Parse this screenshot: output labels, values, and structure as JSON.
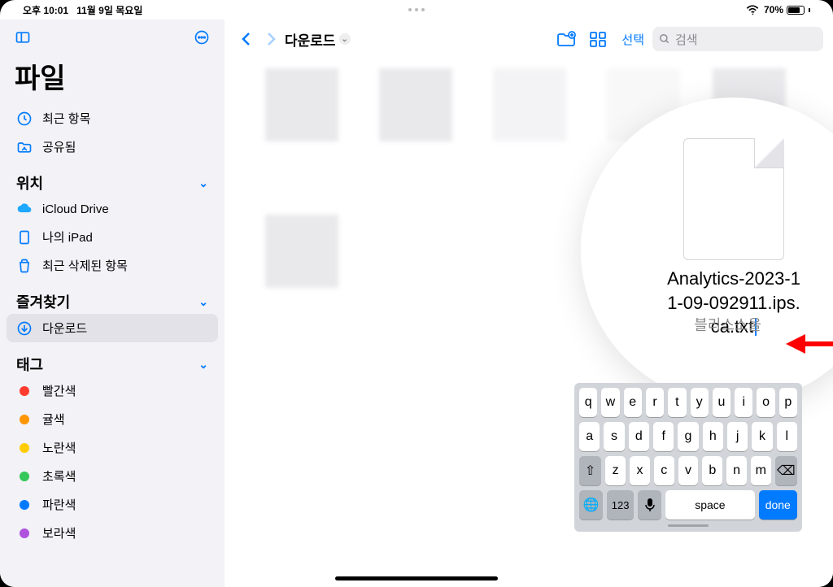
{
  "status": {
    "time": "오후 10:01",
    "date": "11월 9일 목요일",
    "batteryText": "70%"
  },
  "sidebar": {
    "panelIcon": "panel-toggle-icon",
    "moreIcon": "more-icon",
    "appTitle": "파일",
    "recents": "최근 항목",
    "shared": "공유됨",
    "locationsHeader": "위치",
    "locations": {
      "icloud": "iCloud Drive",
      "ipad": "나의 iPad",
      "trash": "최근 삭제된 항목"
    },
    "favoritesHeader": "즐겨찾기",
    "favorites": {
      "downloads": "다운로드"
    },
    "tagsHeader": "태그",
    "tags": [
      {
        "label": "빨간색",
        "color": "#ff3b30"
      },
      {
        "label": "귤색",
        "color": "#ff9500"
      },
      {
        "label": "노란색",
        "color": "#ffcc00"
      },
      {
        "label": "초록색",
        "color": "#34c759"
      },
      {
        "label": "파란색",
        "color": "#007aff"
      },
      {
        "label": "보라색",
        "color": "#af52de"
      }
    ]
  },
  "toolbar": {
    "breadcrumb": "다운로드",
    "select": "선택",
    "searchPlaceholder": "검색"
  },
  "popup": {
    "filenameLine1": "Analytics-2023-1",
    "filenameLine2": "1-09-092911.ips.",
    "filenameLine3": "ca.txt"
  },
  "watermark": "블리스소울",
  "keyboard": {
    "row1": [
      "q",
      "w",
      "e",
      "r",
      "t",
      "y",
      "u",
      "i",
      "o",
      "p"
    ],
    "row2": [
      "a",
      "s",
      "d",
      "f",
      "g",
      "h",
      "j",
      "k",
      "l"
    ],
    "row3": [
      "⇧",
      "z",
      "x",
      "c",
      "v",
      "b",
      "n",
      "m",
      "⌫"
    ],
    "globe": "🌐",
    "numbers": "123",
    "mic": "🎤",
    "space": "space",
    "done": "done"
  }
}
